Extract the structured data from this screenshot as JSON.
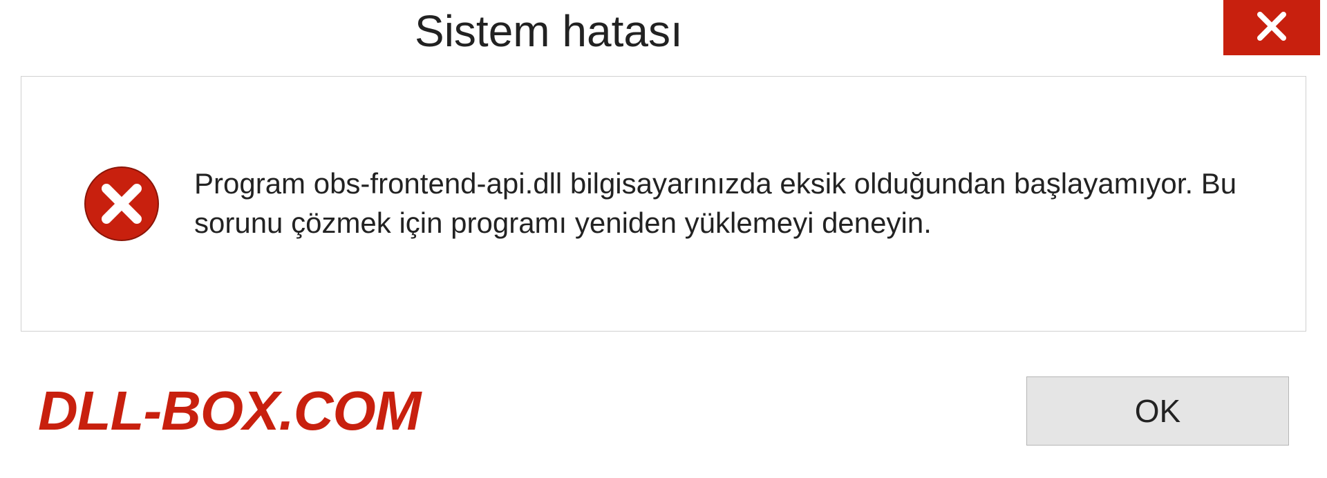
{
  "dialog": {
    "title": "Sistem hatası",
    "message": "Program obs-frontend-api.dll bilgisayarınızda eksik olduğundan başlayamıyor. Bu sorunu çözmek için programı yeniden yüklemeyi deneyin.",
    "ok_label": "OK"
  },
  "watermark": "DLL-BOX.COM",
  "colors": {
    "close_button": "#c8200e",
    "error_icon": "#c8200e",
    "watermark": "#c8200e"
  },
  "icons": {
    "close": "close-icon",
    "error": "error-icon"
  }
}
